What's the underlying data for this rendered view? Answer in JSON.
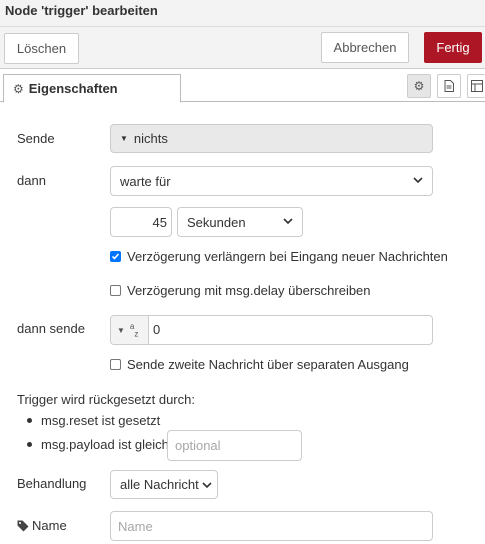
{
  "dialog": {
    "title": "Node 'trigger' bearbeiten"
  },
  "toolbar": {
    "delete_label": "Löschen",
    "cancel_label": "Abbrechen",
    "done_label": "Fertig"
  },
  "tabs": {
    "properties_label": "Eigenschaften"
  },
  "form": {
    "send_label": "Sende",
    "send_value": "nichts",
    "then_label": "dann",
    "then_value": "warte für",
    "duration_value": "45",
    "units_value": "Sekunden",
    "extend_delay_label": "Verzögerung verlängern bei Eingang neuer Nachrichten",
    "extend_delay_checked": true,
    "override_delay_label": "Verzögerung mit msg.delay überschreiben",
    "override_delay_checked": false,
    "then_send_label": "dann sende",
    "then_send_type_icon": "az",
    "then_send_value": "0",
    "second_output_label": "Sende zweite Nachricht über separaten Ausgang",
    "second_output_checked": false,
    "reset_heading": "Trigger wird rückgesetzt durch:",
    "reset_item_1": "msg.reset ist gesetzt",
    "reset_item_2": "msg.payload ist gleich",
    "reset_payload_placeholder": "optional",
    "handling_label": "Behandlung",
    "handling_value": "alle Nachricht",
    "name_label": "Name",
    "name_placeholder": "Name"
  },
  "icons": {
    "settings": "gear-icon",
    "description": "document-icon",
    "appearance": "layout-icon",
    "tag": "tag-icon"
  },
  "colors": {
    "done_button": "#ad1625",
    "checkbox_checked": "#0075ff"
  }
}
